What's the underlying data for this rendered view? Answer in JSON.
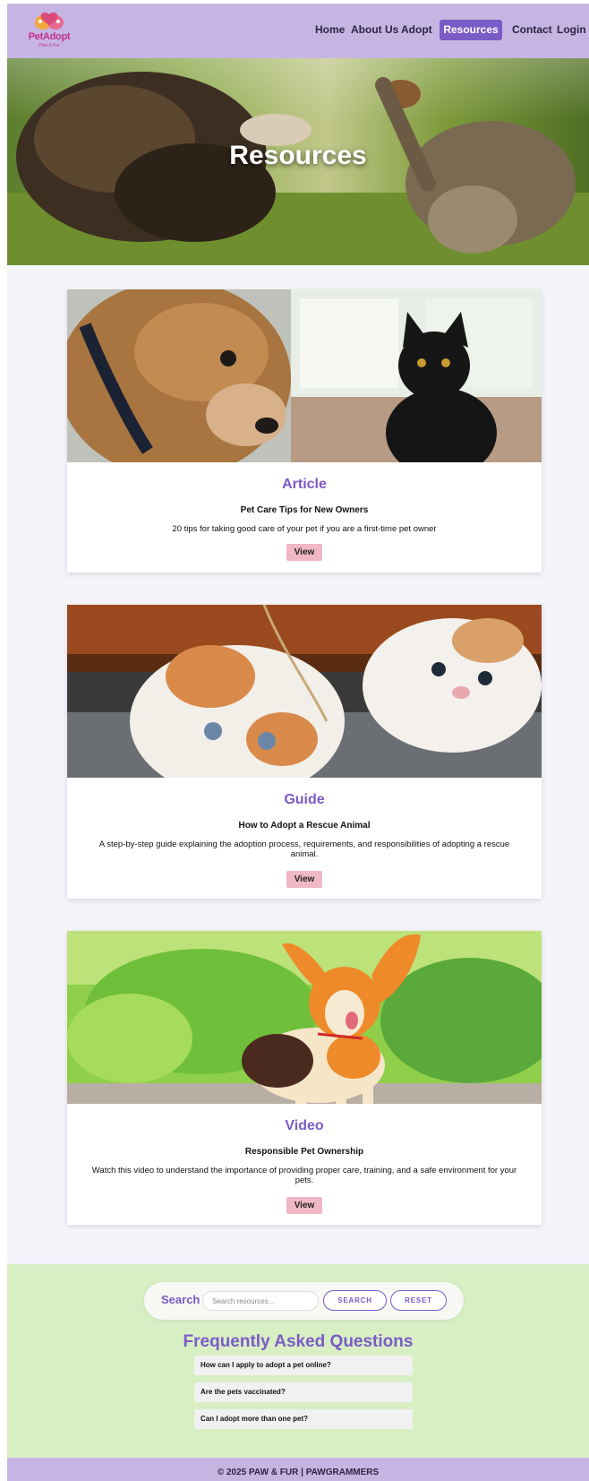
{
  "nav": {
    "logo_text": "PetAdopt",
    "logo_tagline": "Paw & Fur",
    "links": [
      "Home",
      "About Us",
      "Adopt",
      "Resources",
      "Contact",
      "Login"
    ],
    "active": "Resources"
  },
  "hero": {
    "title": "Resources"
  },
  "resources": [
    {
      "type": "Article",
      "title": "Pet Care Tips for New Owners",
      "description": "20 tips for taking good care of your pet if you are a first-time pet owner",
      "button": "View"
    },
    {
      "type": "Guide",
      "title": "How to Adopt a Rescue Animal",
      "description": "A step-by-step guide explaining the adoption process, requirements, and responsibilities of adopting a rescue animal.",
      "button": "View"
    },
    {
      "type": "Video",
      "title": "Responsible Pet Ownership",
      "description": "Watch this video to understand the importance of providing proper care, training, and a safe environment for your pets.",
      "button": "View"
    }
  ],
  "search": {
    "label": "Search",
    "placeholder": "Search resources...",
    "search_button": "SEARCH",
    "reset_button": "RESET"
  },
  "faq": {
    "title": "Frequently Asked Questions",
    "items": [
      "How can I apply to adopt a pet online?",
      "Are the pets vaccinated?",
      "Can I adopt more than one pet?"
    ]
  },
  "footer": {
    "text": "© 2025 PAW & FUR | PAWGRAMMERS"
  },
  "colors": {
    "accent": "#7b5bc6",
    "nav_bg": "#c6b5e3",
    "footer_green": "#d8efc4",
    "view_button": "#f0b7c6"
  }
}
